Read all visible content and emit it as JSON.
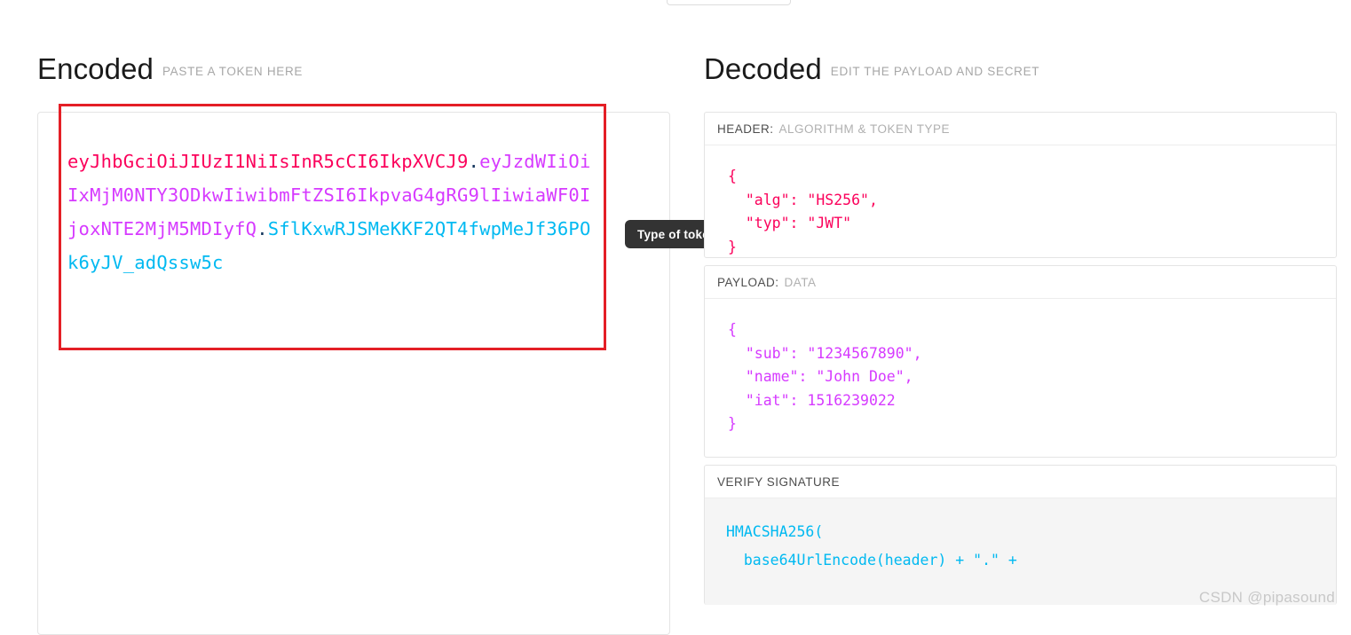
{
  "top_control": {
    "label": ""
  },
  "encoded": {
    "title": "Encoded",
    "subtitle": "PASTE A TOKEN HERE",
    "token": {
      "header_part": "eyJhbGciOiJIUzI1NiIsInR5cCI6IkpXVCJ9",
      "dot1": ".",
      "payload_part": "eyJzdWIiOiIxMjM0NTY3ODkwIiwibmFtZSI6IkpvaG4gRG9lIiwiaWF0IjoxNTE2MjM5MDIyfQ",
      "dot2": ".",
      "signature_part": "SflKxwRJSMeKKF2QT4fwpMeJf36POk6yJV_adQssw5c",
      "full": "eyJhbGciOiJIUzI1NiIsInR5cCI6IkpXVCJ9.eyJzdWIiOiIxMjM0NTY3ODkwIiwibmFtZSI6IkpvaG4gRG9lIiwiaWF0IjoxNTE2MjM5MDIyfQ.SflKxwRJSMeKKF2QT4fwpMeJf36POk6yJV_adQssw5c"
    },
    "colors": {
      "header": "#fb015b",
      "payload": "#d63aff",
      "signature": "#00b9f1",
      "separator": "#14365d",
      "annotation_box": "#e41f26"
    }
  },
  "tooltip": {
    "text": "Type of token"
  },
  "decoded": {
    "title": "Decoded",
    "subtitle": "EDIT THE PAYLOAD AND SECRET",
    "header_section": {
      "label_strong": "HEADER:",
      "label_soft": "ALGORITHM & TOKEN TYPE",
      "json": "{\n  \"alg\": \"HS256\",\n  \"typ\": \"JWT\"\n}",
      "color": "#fb015b"
    },
    "payload_section": {
      "label_strong": "PAYLOAD:",
      "label_soft": "DATA",
      "json": "{\n  \"sub\": \"1234567890\",\n  \"name\": \"John Doe\",\n  \"iat\": 1516239022\n}",
      "color": "#d63aff"
    },
    "signature_section": {
      "label_strong": "VERIFY SIGNATURE",
      "label_soft": "",
      "code": "HMACSHA256(\n  base64UrlEncode(header) + \".\" +",
      "color": "#00b9f1"
    }
  },
  "watermark": {
    "text": "CSDN @pipasound"
  }
}
